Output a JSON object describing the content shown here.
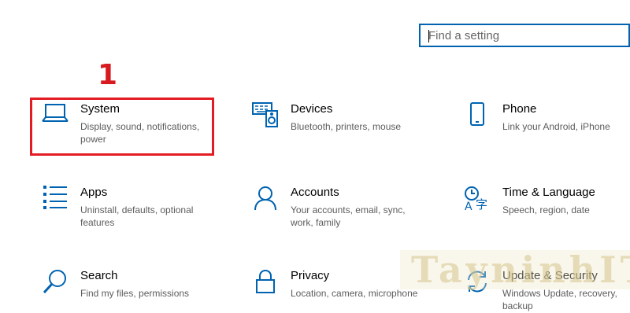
{
  "search": {
    "placeholder": "Find a setting"
  },
  "annotation": {
    "step_number": "1",
    "color": "#e31b23"
  },
  "accent_color": "#0063b1",
  "tiles": [
    {
      "icon": "laptop-icon",
      "title": "System",
      "description": "Display, sound, notifications, power"
    },
    {
      "icon": "devices-icon",
      "title": "Devices",
      "description": "Bluetooth, printers, mouse"
    },
    {
      "icon": "phone-icon",
      "title": "Phone",
      "description": "Link your Android, iPhone"
    },
    {
      "icon": "apps-list-icon",
      "title": "Apps",
      "description": "Uninstall, defaults, optional features"
    },
    {
      "icon": "person-icon",
      "title": "Accounts",
      "description": "Your accounts, email, sync, work, family"
    },
    {
      "icon": "time-language-icon",
      "title": "Time & Language",
      "description": "Speech, region, date"
    },
    {
      "icon": "search-icon",
      "title": "Search",
      "description": "Find my files, permissions"
    },
    {
      "icon": "lock-icon",
      "title": "Privacy",
      "description": "Location, camera, microphone"
    },
    {
      "icon": "sync-icon",
      "title": "Update & Security",
      "description": "Windows Update, recovery, backup"
    }
  ],
  "watermark": {
    "text": "TayninhIT"
  }
}
